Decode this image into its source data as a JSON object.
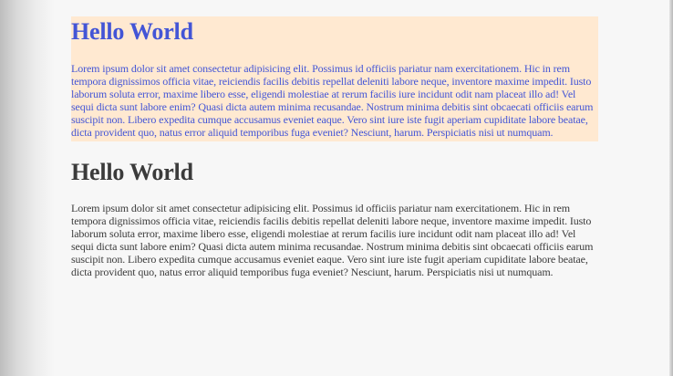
{
  "sections": [
    {
      "heading": "Hello World",
      "paragraph": "Lorem ipsum dolor sit amet consectetur adipisicing elit. Possimus id officiis pariatur nam exercitationem. Hic in rem tempora dignissimos officia vitae, reiciendis facilis debitis repellat deleniti labore neque, inventore maxime impedit. Iusto laborum soluta error, maxime libero esse, eligendi molestiae at rerum facilis iure incidunt odit nam placeat illo ad! Vel sequi dicta sunt labore enim? Quasi dicta autem minima recusandae. Nostrum minima debitis sint obcaecati officiis earum suscipit non. Libero expedita cumque accusamus eveniet eaque. Vero sint iure iste fugit aperiam cupiditate labore beatae, dicta provident quo, natus error aliquid temporibus fuga eveniet? Nesciunt, harum. Perspiciatis nisi ut numquam.",
      "text_color": "#4355d6",
      "background_color": "#ffe9d1"
    },
    {
      "heading": "Hello World",
      "paragraph": "Lorem ipsum dolor sit amet consectetur adipisicing elit. Possimus id officiis pariatur nam exercitationem. Hic in rem tempora dignissimos officia vitae, reiciendis facilis debitis repellat deleniti labore neque, inventore maxime impedit. Iusto laborum soluta error, maxime libero esse, eligendi molestiae at rerum facilis iure incidunt odit nam placeat illo ad! Vel sequi dicta sunt labore enim? Quasi dicta autem minima recusandae. Nostrum minima debitis sint obcaecati officiis earum suscipit non. Libero expedita cumque accusamus eveniet eaque. Vero sint iure iste fugit aperiam cupiditate labore beatae, dicta provident quo, natus error aliquid temporibus fuga eveniet? Nesciunt, harum. Perspiciatis nisi ut numquam.",
      "text_color": "#3b3b3b"
    }
  ]
}
